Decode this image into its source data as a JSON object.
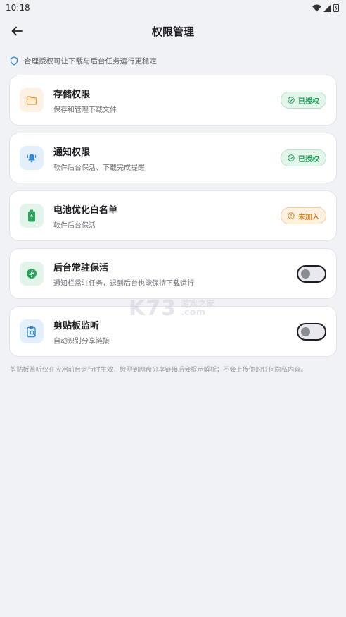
{
  "status_bar": {
    "time": "10:18"
  },
  "header": {
    "title": "权限管理"
  },
  "tip": {
    "text": "合理授权可让下载与后台任务运行更稳定"
  },
  "permissions": [
    {
      "title": "存储权限",
      "subtitle": "保存和管理下载文件",
      "icon": "folder-icon",
      "icon_bg": "#fdf1e3",
      "icon_color": "#e69a3c",
      "status": "已授权"
    },
    {
      "title": "通知权限",
      "subtitle": "软件后台保活、下载完成提醒",
      "icon": "bell-icon",
      "icon_bg": "#e3f0fc",
      "icon_color": "#2f86d6",
      "status": "已授权"
    },
    {
      "title": "电池优化白名单",
      "subtitle": "软件后台保活",
      "icon": "battery-icon",
      "icon_bg": "#e3f5ea",
      "icon_color": "#27a35c",
      "status": "未加入"
    },
    {
      "title": "后台常驻保活",
      "subtitle": "通知栏常驻任务，退到后台也能保持下载运行",
      "icon": "running-icon",
      "icon_bg": "#e3f5ea",
      "icon_color": "#27a35c",
      "enabled": false
    },
    {
      "title": "剪贴板监听",
      "subtitle": "自动识别分享链接",
      "icon": "clipboard-search-icon",
      "icon_bg": "#e3f0fc",
      "icon_color": "#2f86d6",
      "enabled": false
    }
  ],
  "footnote": "剪贴板监听仅在应用前台运行时生效，检测到网盘分享链接后会提示解析；不会上传你的任何隐私内容。",
  "watermark": {
    "main": "K73",
    "cn": "游戏之家",
    "com": ".com"
  },
  "colors": {
    "success": "#1f9a55",
    "warning": "#d7831f",
    "background": "#f1f2f6"
  }
}
